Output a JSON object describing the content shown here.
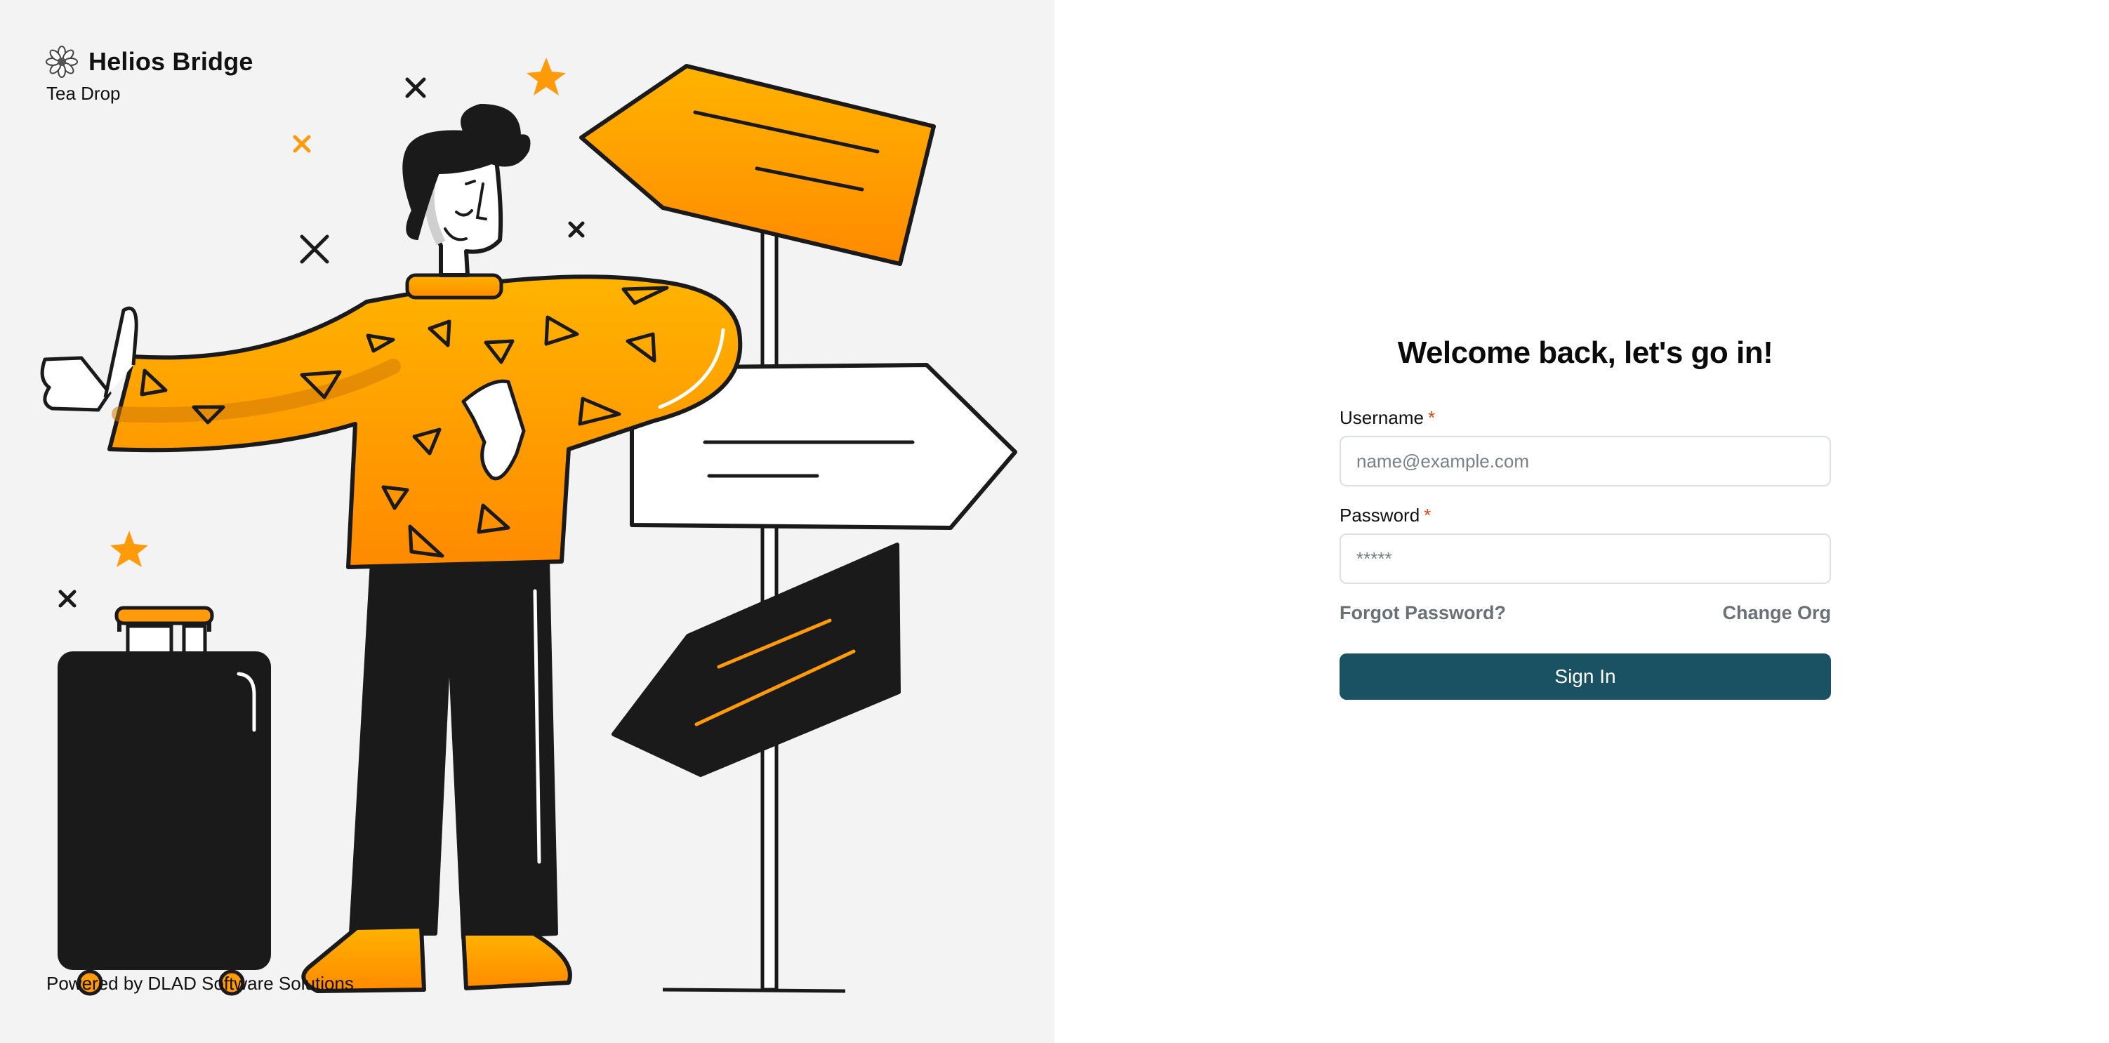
{
  "brand": {
    "logo_icon": "flower-logo-icon",
    "title": "Helios Bridge",
    "subtitle": "Tea Drop"
  },
  "footer": {
    "powered_by": "Powered by DLAD Software Solutions"
  },
  "illustration": {
    "name": "person-at-signpost-illustration",
    "accent_color": "#ff9a0b",
    "ink_color": "#1a1a1a"
  },
  "login": {
    "title": "Welcome back, let's go in!",
    "username": {
      "label": "Username",
      "required_mark": "*",
      "placeholder": "name@example.com",
      "value": ""
    },
    "password": {
      "label": "Password",
      "required_mark": "*",
      "placeholder": "*****",
      "value": ""
    },
    "forgot_password": "Forgot Password?",
    "change_org": "Change Org",
    "sign_in": "Sign In"
  },
  "colors": {
    "primary_button": "#1b5263",
    "required": "#d9480f",
    "accent": "#ff9a0b",
    "left_background": "#f3f3f3"
  }
}
